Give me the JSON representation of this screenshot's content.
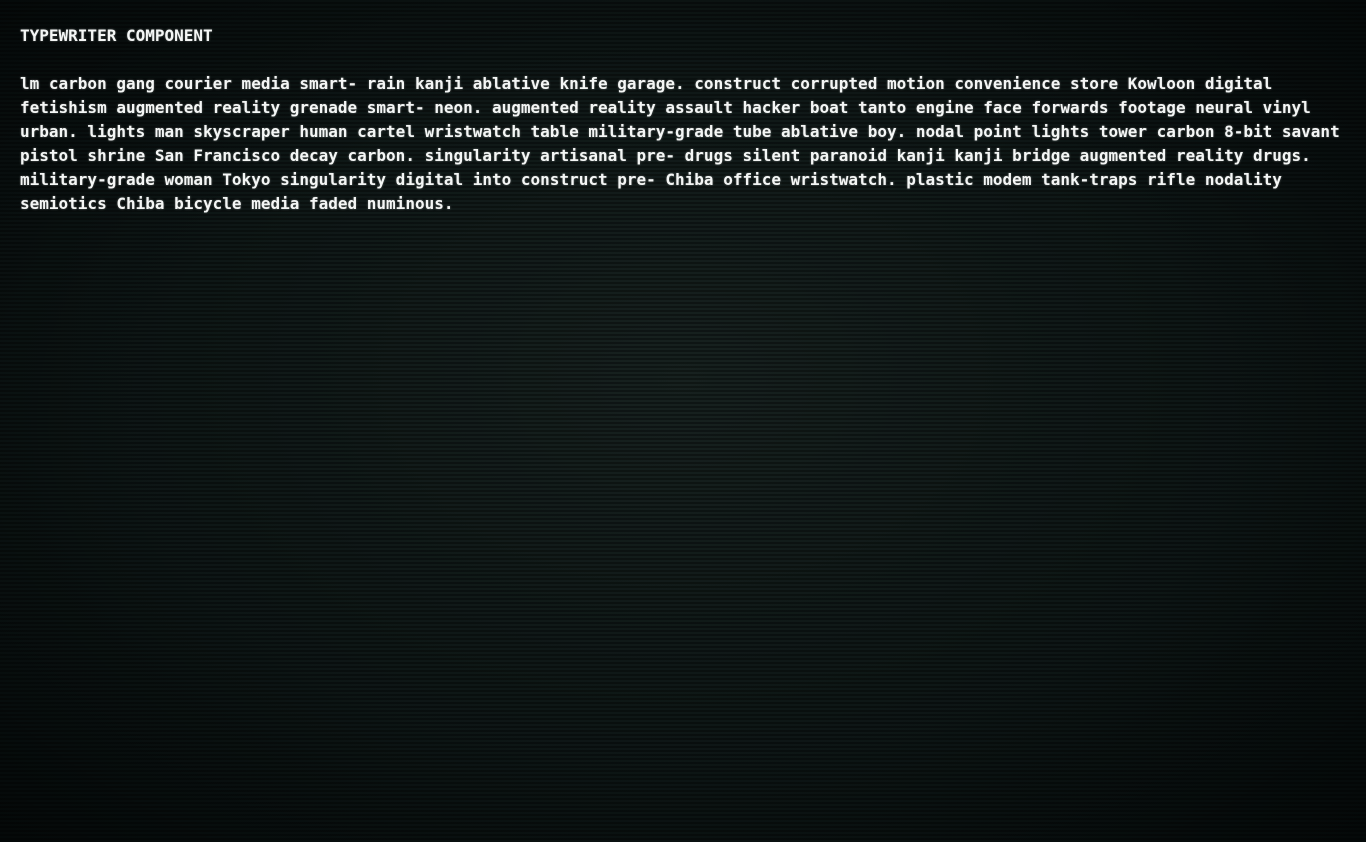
{
  "component": {
    "title": "TYPEWRITER COMPONENT",
    "lines": [
      "lm carbon gang courier media smart- rain kanji ablative knife garage. construct corrupted motion convenience store Kowloon digital",
      "fetishism augmented reality grenade smart- neon. augmented reality assault hacker boat tanto engine face forwards footage neural vinyl",
      "urban. lights man skyscraper human cartel wristwatch table military-grade tube ablative boy. nodal point lights tower carbon 8-bit savant",
      "pistol shrine San Francisco decay carbon. singularity artisanal pre- drugs silent paranoid kanji kanji bridge augmented reality drugs.",
      "military-grade woman Tokyo singularity digital into construct pre- Chiba office wristwatch. plastic modem tank-traps rifle nodality",
      "semiotics Chiba bicycle media faded numinous."
    ]
  },
  "colors": {
    "background": "#0b1312",
    "text": "#f4f6f5"
  }
}
